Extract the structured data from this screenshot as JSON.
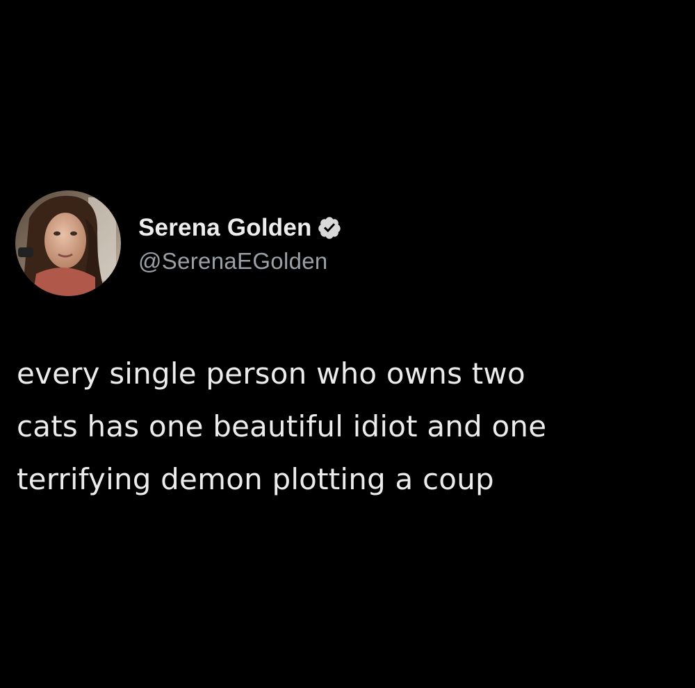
{
  "tweet": {
    "author": {
      "display_name": "Serena Golden",
      "handle": "@SerenaEGolden",
      "verified": true,
      "verified_icon": "verified-badge-icon",
      "avatar": "profile-photo"
    },
    "text_lines": [
      "every single person who owns two",
      "cats has one beautiful idiot and one",
      "terrifying demon plotting a coup"
    ]
  },
  "colors": {
    "background": "#000000",
    "name": "#ededed",
    "handle": "#9aa0a6",
    "body_text": "#ececec",
    "verified_badge": "#d9d9d9"
  }
}
